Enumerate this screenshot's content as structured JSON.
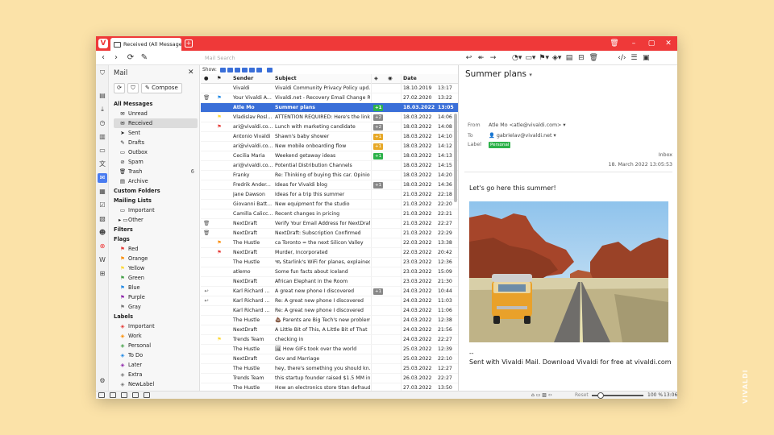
{
  "tab": {
    "title": "Received (All Messages)"
  },
  "toolbar": {
    "address_placeholder": "Mail Search"
  },
  "mailpanel": {
    "title": "Mail",
    "compose_label": "Compose",
    "tree": [
      {
        "label": "All Messages",
        "level": 0,
        "icon": "",
        "hdr": true
      },
      {
        "label": "Unread",
        "level": 1,
        "icon": "✉"
      },
      {
        "label": "Received",
        "level": 1,
        "icon": "✉",
        "selected": true
      },
      {
        "label": "Sent",
        "level": 1,
        "icon": "➤"
      },
      {
        "label": "Drafts",
        "level": 1,
        "icon": "✎"
      },
      {
        "label": "Outbox",
        "level": 1,
        "icon": "▭"
      },
      {
        "label": "Spam",
        "level": 1,
        "icon": "⊘"
      },
      {
        "label": "Trash",
        "level": 1,
        "icon": "🗑",
        "count": "6"
      },
      {
        "label": "Archive",
        "level": 1,
        "icon": "▤"
      },
      {
        "label": "Custom Folders",
        "level": 0,
        "hdr": true
      },
      {
        "label": "Mailing Lists",
        "level": 0,
        "hdr": true
      },
      {
        "label": "Important",
        "level": 1,
        "icon": "▭"
      },
      {
        "label": "Other",
        "level": 1,
        "icon": "▸ ▭"
      },
      {
        "label": "Filters",
        "level": 0,
        "hdr": true
      },
      {
        "label": "Flags",
        "level": 0,
        "hdr": true
      },
      {
        "label": "Red",
        "level": 1,
        "icon": "⚑",
        "color": "#e53935"
      },
      {
        "label": "Orange",
        "level": 1,
        "icon": "⚑",
        "color": "#fb8c00"
      },
      {
        "label": "Yellow",
        "level": 1,
        "icon": "⚑",
        "color": "#fdd835"
      },
      {
        "label": "Green",
        "level": 1,
        "icon": "⚑",
        "color": "#43a047"
      },
      {
        "label": "Blue",
        "level": 1,
        "icon": "⚑",
        "color": "#1e88e5"
      },
      {
        "label": "Purple",
        "level": 1,
        "icon": "⚑",
        "color": "#8e24aa"
      },
      {
        "label": "Gray",
        "level": 1,
        "icon": "⚑",
        "color": "#757575"
      },
      {
        "label": "Labels",
        "level": 0,
        "hdr": true
      },
      {
        "label": "Important",
        "level": 1,
        "icon": "◈",
        "color": "#e53935"
      },
      {
        "label": "Work",
        "level": 1,
        "icon": "◈",
        "color": "#fb8c00"
      },
      {
        "label": "Personal",
        "level": 1,
        "icon": "◈",
        "color": "#43a047"
      },
      {
        "label": "To Do",
        "level": 1,
        "icon": "◈",
        "color": "#1e88e5"
      },
      {
        "label": "Later",
        "level": 1,
        "icon": "◈",
        "color": "#8e24aa"
      },
      {
        "label": "Extra",
        "level": 1,
        "icon": "◈",
        "color": "#757575"
      },
      {
        "label": "NewLabel",
        "level": 1,
        "icon": "◈",
        "color": "#757575"
      }
    ]
  },
  "list": {
    "show_label": "Show:",
    "headers": {
      "sender": "Sender",
      "subject": "Subject",
      "date": "Date"
    },
    "rows": [
      {
        "star": "",
        "flag": "",
        "sender": "Vivaldi",
        "subject": "Vivaldi Community Privacy Policy upd...",
        "label": "",
        "date": "18.10.2019",
        "time": "13:17"
      },
      {
        "star": "🗑",
        "flag": "⚑",
        "flagc": "#1e88e5",
        "sender": "Your Vivaldi A...",
        "subject": "Vivaldi.net - Recovery Email Change R...",
        "label": "",
        "date": "27.02.2020",
        "time": "13:22"
      },
      {
        "star": "",
        "flag": "",
        "sender": "Atle Mo",
        "subject": "Summer plans",
        "label": "+1",
        "lc": "g",
        "date": "18.03.2022",
        "time": "13:05",
        "sel": true
      },
      {
        "star": "",
        "flag": "⚑",
        "flagc": "#fdd835",
        "sender": "Vladislav Rosl...",
        "subject": "ATTENTION REQUIRED: Here's the link...",
        "label": "+2",
        "lc": "d",
        "date": "18.03.2022",
        "time": "14:06"
      },
      {
        "star": "",
        "flag": "⚑",
        "flagc": "#e53935",
        "sender": "ari@vivaldi.co...",
        "subject": "Lunch with marketing candidate",
        "label": "+2",
        "lc": "d",
        "date": "18.03.2022",
        "time": "14:08"
      },
      {
        "star": "",
        "flag": "",
        "sender": "Antonio Vivaldi",
        "subject": "Shawn's baby shower",
        "label": "+1",
        "lc": "y",
        "date": "18.03.2022",
        "time": "14:10"
      },
      {
        "star": "",
        "flag": "",
        "sender": "ari@vivaldi.co...",
        "subject": "New mobile onboarding flow",
        "label": "+1",
        "lc": "y",
        "date": "18.03.2022",
        "time": "14:12"
      },
      {
        "star": "",
        "flag": "",
        "sender": "Cecilia Maria",
        "subject": "Weekend getaway ideas",
        "label": "+1",
        "lc": "g",
        "date": "18.03.2022",
        "time": "14:13"
      },
      {
        "star": "",
        "flag": "",
        "sender": "ari@vivaldi.co...",
        "subject": "Potential Distribution Channels",
        "label": "",
        "date": "18.03.2022",
        "time": "14:15"
      },
      {
        "star": "",
        "flag": "",
        "sender": "Franky",
        "subject": "Re: Thinking of buying this car. Opinio...",
        "label": "",
        "date": "18.03.2022",
        "time": "14:20"
      },
      {
        "star": "",
        "flag": "",
        "sender": "Fredrik Ander...",
        "subject": "Ideas for Vivaldi blog",
        "label": "+1",
        "lc": "d",
        "date": "18.03.2022",
        "time": "14:36"
      },
      {
        "star": "",
        "flag": "",
        "sender": "Jane Dawson",
        "subject": "Ideas for a trip this summer",
        "label": "",
        "date": "21.03.2022",
        "time": "22:18"
      },
      {
        "star": "",
        "flag": "",
        "sender": "Giovanni Batt...",
        "subject": "New equipment for the studio",
        "label": "",
        "date": "21.03.2022",
        "time": "22:20"
      },
      {
        "star": "",
        "flag": "",
        "sender": "Camilla Calicc...",
        "subject": "Recent changes in pricing",
        "label": "",
        "date": "21.03.2022",
        "time": "22:21"
      },
      {
        "star": "🗑",
        "flag": "",
        "sender": "NextDraft",
        "subject": "Verify Your Email Address for NextDraft",
        "label": "",
        "date": "21.03.2022",
        "time": "22:27"
      },
      {
        "star": "🗑",
        "flag": "",
        "sender": "NextDraft",
        "subject": "NextDraft: Subscription Confirmed",
        "label": "",
        "date": "21.03.2022",
        "time": "22:29"
      },
      {
        "star": "",
        "flag": "⚑",
        "flagc": "#fb8c00",
        "sender": "The Hustle",
        "subject": "ca Toronto = the next Silicon Valley",
        "label": "",
        "date": "22.03.2022",
        "time": "13:38"
      },
      {
        "star": "",
        "flag": "⚑",
        "flagc": "#e53935",
        "sender": "NextDraft",
        "subject": "Murder, Incorporated",
        "label": "",
        "date": "22.03.2022",
        "time": "20:42"
      },
      {
        "star": "",
        "flag": "",
        "sender": "The Hustle",
        "subject": "🛰 Starlink's WiFi for planes, explained",
        "label": "",
        "date": "23.03.2022",
        "time": "12:36"
      },
      {
        "star": "",
        "flag": "",
        "sender": "atlemo",
        "subject": "Some fun facts about Iceland",
        "label": "",
        "date": "23.03.2022",
        "time": "15:09"
      },
      {
        "star": "",
        "flag": "",
        "sender": "NextDraft",
        "subject": "African Elephant in the Room",
        "label": "",
        "date": "23.03.2022",
        "time": "21:30"
      },
      {
        "star": "↩",
        "flag": "",
        "sender": "Karl Richard ...",
        "subject": "A great new phone I discovered",
        "label": "+1",
        "lc": "d",
        "date": "24.03.2022",
        "time": "10:44"
      },
      {
        "star": "↩",
        "flag": "",
        "sender": "Karl Richard ...",
        "subject": "Re: A great new phone I discovered",
        "label": "",
        "date": "24.03.2022",
        "time": "11:03"
      },
      {
        "star": "",
        "flag": "",
        "sender": "Karl Richard ...",
        "subject": "Re: A great new phone I discovered",
        "label": "",
        "date": "24.03.2022",
        "time": "11:06"
      },
      {
        "star": "",
        "flag": "",
        "sender": "The Hustle",
        "subject": "💩 Parents are Big Tech's new problem",
        "label": "",
        "date": "24.03.2022",
        "time": "12:38"
      },
      {
        "star": "",
        "flag": "",
        "sender": "NextDraft",
        "subject": "A Little Bit of This, A Little Bit of That",
        "label": "",
        "date": "24.03.2022",
        "time": "21:56"
      },
      {
        "star": "",
        "flag": "⚑",
        "flagc": "#fdd835",
        "sender": "Trends Team",
        "subject": "checking in",
        "label": "",
        "date": "24.03.2022",
        "time": "22:27"
      },
      {
        "star": "",
        "flag": "",
        "sender": "The Hustle",
        "subject": "🖼 How GIFs took over the world",
        "label": "",
        "date": "25.03.2022",
        "time": "12:39"
      },
      {
        "star": "",
        "flag": "",
        "sender": "NextDraft",
        "subject": "Gov and Marriage",
        "label": "",
        "date": "25.03.2022",
        "time": "22:10"
      },
      {
        "star": "",
        "flag": "",
        "sender": "The Hustle",
        "subject": "hey, there's something you should kn...",
        "label": "",
        "date": "25.03.2022",
        "time": "12:27"
      },
      {
        "star": "",
        "flag": "",
        "sender": "Trends Team",
        "subject": "this startup founder raised $1.5 MM in...",
        "label": "",
        "date": "26.03.2022",
        "time": "22:27"
      },
      {
        "star": "",
        "flag": "",
        "sender": "The Hustle",
        "subject": "How an electronics store titan defraud...",
        "label": "",
        "date": "27.03.2022",
        "time": "13:50"
      }
    ]
  },
  "reader": {
    "title": "Summer plans",
    "from_label": "From",
    "from_value": "Atle Mo <atle@vivaldi.com>",
    "to_label": "To",
    "to_value": "gabrielav@vivaldi.net",
    "label_label": "Label",
    "label_value": "Personal",
    "folder": "Inbox",
    "date": "18. March 2022 13:05:53",
    "body_line1": "Let's go here this summer!",
    "body_sig_dash": "--",
    "body_sig": "Sent with Vivaldi Mail. Download Vivaldi for free at vivaldi.com"
  },
  "status": {
    "reset_label": "Reset",
    "zoom": "100 %",
    "clock": "13:06"
  },
  "brand": {
    "watermark": "VIVALDI",
    "accent": "#ef3939",
    "selection": "#3a6fd8"
  }
}
